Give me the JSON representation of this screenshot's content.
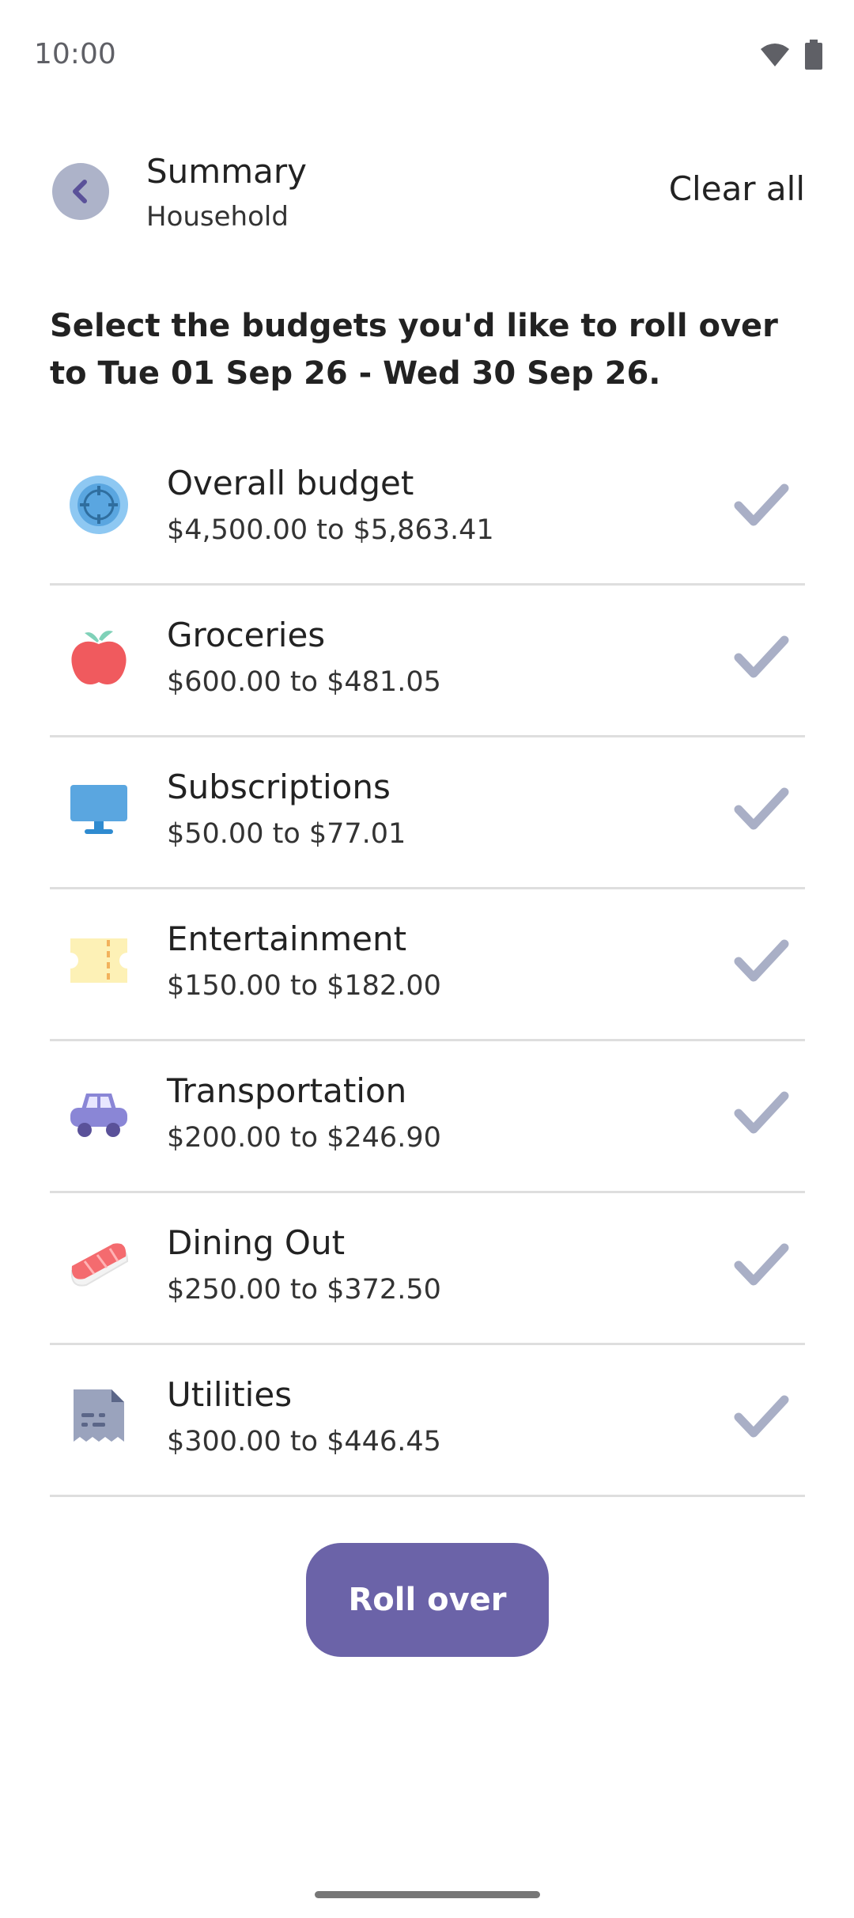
{
  "status": {
    "time": "10:00"
  },
  "header": {
    "title": "Summary",
    "subtitle": "Household",
    "clear_label": "Clear all"
  },
  "intro_text": "Select the budgets you'd like to roll over to Tue 01 Sep 26 - Wed 30 Sep 26.",
  "budgets": [
    {
      "name": "Overall budget",
      "range": "$4,500.00 to $5,863.41",
      "icon": "target-icon",
      "checked": true
    },
    {
      "name": "Groceries",
      "range": "$600.00 to $481.05",
      "icon": "apple-icon",
      "checked": true
    },
    {
      "name": "Subscriptions",
      "range": "$50.00 to $77.01",
      "icon": "monitor-icon",
      "checked": true
    },
    {
      "name": "Entertainment",
      "range": "$150.00 to $182.00",
      "icon": "ticket-icon",
      "checked": true
    },
    {
      "name": "Transportation",
      "range": "$200.00 to $246.90",
      "icon": "car-icon",
      "checked": true
    },
    {
      "name": "Dining Out",
      "range": "$250.00 to $372.50",
      "icon": "sushi-icon",
      "checked": true
    },
    {
      "name": "Utilities",
      "range": "$300.00 to $446.45",
      "icon": "bill-icon",
      "checked": true
    }
  ],
  "action": {
    "roll_over_label": "Roll over"
  },
  "colors": {
    "accent": "#6b63a8",
    "check": "#a9afc6",
    "divider": "#dedede"
  }
}
